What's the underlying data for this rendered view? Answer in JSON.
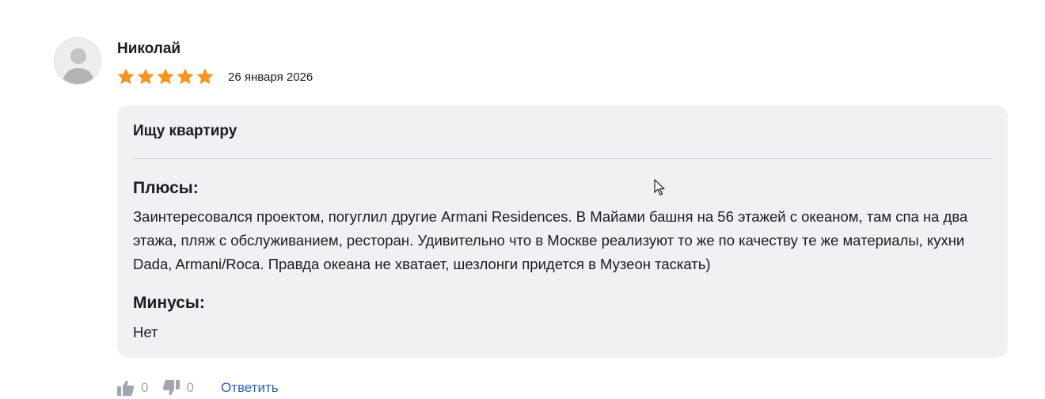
{
  "review": {
    "author": "Николай",
    "rating": 5,
    "rating_max": 5,
    "date": "26 января 2026",
    "title": "Ищу квартиру",
    "pros_heading": "Плюсы:",
    "pros_text": "Заинтересовался проектом, погуглил другие Armani Residences. В Майами башня на 56 этажей с океаном, там спа на два этажа, пляж с обслуживанием, ресторан. Удивительно что в Москве реализуют то же по качеству те же материалы, кухни Dada, Armani/Roca. Правда океана не хватает, шезлонги придется в Музеон таскать)",
    "cons_heading": "Минусы:",
    "cons_text": "Нет"
  },
  "actions": {
    "likes": "0",
    "dislikes": "0",
    "reply_label": "Ответить"
  },
  "icons": {
    "avatar": "user-avatar-placeholder",
    "star": "star-icon",
    "like": "thumbs-up-icon",
    "dislike": "thumbs-down-icon",
    "cursor": "mouse-pointer-icon"
  },
  "colors": {
    "star": "#f7931e",
    "card_bg": "#f0f1f3",
    "link": "#2b5fb8",
    "muted": "#a2a6b0",
    "text": "#1a1c23"
  }
}
